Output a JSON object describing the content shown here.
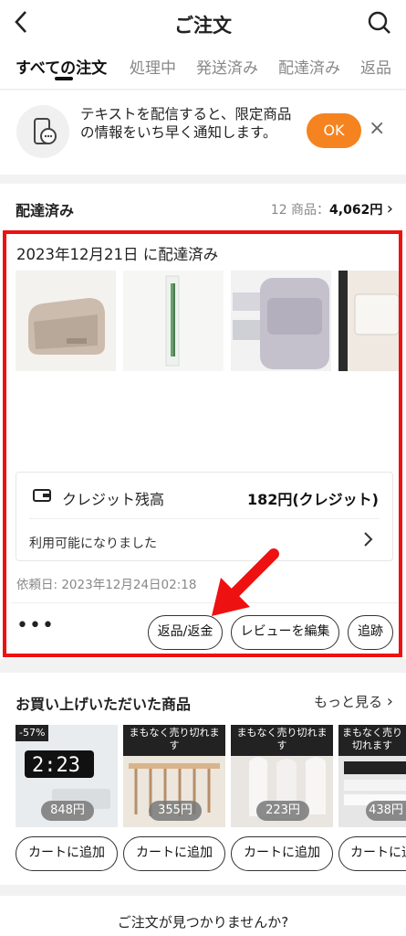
{
  "header": {
    "title": "ご注文",
    "back_icon": "chevron-left-icon",
    "search_icon": "search-icon"
  },
  "tabs": [
    {
      "label": "すべての注文",
      "active": true
    },
    {
      "label": "処理中"
    },
    {
      "label": "発送済み"
    },
    {
      "label": "配達済み"
    },
    {
      "label": "返品"
    }
  ],
  "notification": {
    "text": "テキストを配信すると、限定商品の情報をいち早く通知します。",
    "ok_label": "OK",
    "close_label": "×"
  },
  "delivered_section": {
    "title": "配達済み",
    "summary_prefix": "12 商品：",
    "summary_total": "4,062円",
    "chevron": "›"
  },
  "order": {
    "delivered_date": "2023年12月21日 に配達済み",
    "credit_label": "クレジット残高",
    "credit_amount": "182円(クレジット)",
    "credit_status": "利用可能になりました",
    "request_date": "依頼日: 2023年12月24日02:18",
    "more_dots": "•••",
    "actions": [
      "返品/返金",
      "レビューを編集",
      "追跡"
    ]
  },
  "purchased": {
    "title": "お買い上げいただいた商品",
    "more_label": "もっと見る",
    "items": [
      {
        "badge": "-57%",
        "price": "848円",
        "cart": "カートに追加"
      },
      {
        "badge": "まもなく売り切れます",
        "price": "355円",
        "cart": "カートに追加"
      },
      {
        "badge": "まもなく売り切れます",
        "price": "223円",
        "cart": "カートに追加"
      },
      {
        "badge": "まもなく売り切れます",
        "price": "438円",
        "cart": "カートに追加"
      }
    ]
  },
  "footer": {
    "text": "ご注文が見つかりませんか?"
  },
  "colors": {
    "accent": "#f5831f",
    "highlight": "#ee1111"
  }
}
